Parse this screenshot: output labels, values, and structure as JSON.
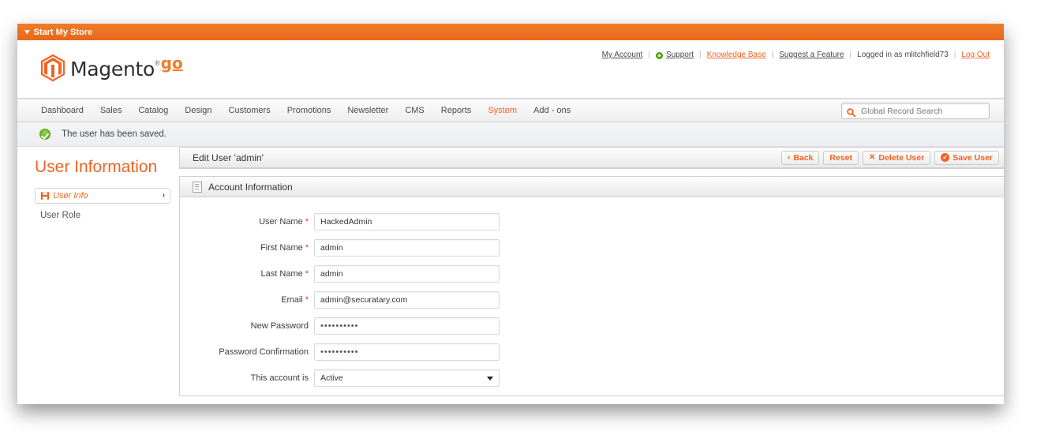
{
  "store_bar": {
    "label": "Start My Store",
    "chevron_icon": "chevron-down-icon"
  },
  "brand": {
    "name": "Magento",
    "suffix": "go",
    "registered": "®"
  },
  "account_links": {
    "my_account": "My Account",
    "support": "Support",
    "knowledge_base": "Knowledge Base",
    "suggest_feature": "Suggest a Feature",
    "logged_in_as": "Logged in as mlitchfield73",
    "log_out": "Log Out",
    "separator": "|"
  },
  "nav": {
    "items": [
      {
        "label": "Dashboard",
        "active": false
      },
      {
        "label": "Sales",
        "active": false
      },
      {
        "label": "Catalog",
        "active": false
      },
      {
        "label": "Design",
        "active": false
      },
      {
        "label": "Customers",
        "active": false
      },
      {
        "label": "Promotions",
        "active": false
      },
      {
        "label": "Newsletter",
        "active": false
      },
      {
        "label": "CMS",
        "active": false
      },
      {
        "label": "Reports",
        "active": false
      },
      {
        "label": "System",
        "active": true
      },
      {
        "label": "Add - ons",
        "active": false
      }
    ]
  },
  "search": {
    "placeholder": "Global Record Search",
    "value": "",
    "icon": "search-icon"
  },
  "message": {
    "text": "The user has been saved.",
    "type": "success",
    "icon": "check-circle-icon"
  },
  "sidebar": {
    "title": "User Information",
    "active_tab": {
      "label": "User Info",
      "icon": "disk-save-icon",
      "chevron": "›"
    },
    "items": [
      {
        "label": "User Role"
      }
    ]
  },
  "content": {
    "title": "Edit User 'admin'",
    "buttons": [
      {
        "label": "Back",
        "glyph": "‹",
        "glyph_type": "chevron",
        "name": "back-button"
      },
      {
        "label": "Reset",
        "glyph": "",
        "glyph_type": "none",
        "name": "reset-button"
      },
      {
        "label": "Delete User",
        "glyph": "✕",
        "glyph_type": "cross",
        "name": "delete-user-button"
      },
      {
        "label": "Save User",
        "glyph": "✓",
        "glyph_type": "circle",
        "name": "save-user-button"
      }
    ],
    "section": {
      "title": "Account Information",
      "icon": "document-icon"
    },
    "fields": [
      {
        "label": "User Name",
        "required": true,
        "value": "HackedAdmin",
        "type": "text",
        "name": "user-name-field"
      },
      {
        "label": "First Name",
        "required": true,
        "value": "admin",
        "type": "text",
        "name": "first-name-field"
      },
      {
        "label": "Last Name",
        "required": true,
        "value": "admin",
        "type": "text",
        "name": "last-name-field"
      },
      {
        "label": "Email",
        "required": true,
        "value": "admin@securatary.com",
        "type": "text",
        "name": "email-field"
      },
      {
        "label": "New Password",
        "required": false,
        "value": "••••••••••",
        "type": "password",
        "name": "new-password-field"
      },
      {
        "label": "Password Confirmation",
        "required": false,
        "value": "••••••••••",
        "type": "password",
        "name": "password-confirmation-field"
      },
      {
        "label": "This account is",
        "required": false,
        "value": "Active",
        "type": "select",
        "name": "account-status-select"
      }
    ],
    "required_marker": "*"
  },
  "colors": {
    "brand_orange": "#f26322",
    "bar_orange": "#e7681a",
    "required_red": "#e7302c",
    "success_green": "#5fa01c"
  }
}
